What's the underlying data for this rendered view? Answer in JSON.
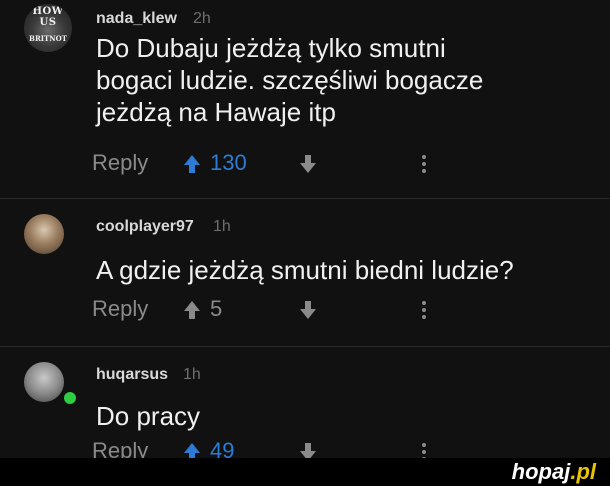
{
  "comments": [
    {
      "avatar_text_top": "HOW US",
      "avatar_text_bottom": "BRITNOT",
      "username": "nada_klew",
      "time": "2h",
      "text_lines": [
        "Do Dubaju jeżdżą tylko smutni",
        "bogaci ludzie. szczęśliwi bogacze",
        "jeżdżą na Hawaje itp"
      ],
      "reply_label": "Reply",
      "score": "130",
      "upvoted": true
    },
    {
      "username": "coolplayer97",
      "time": "1h",
      "text_lines": [
        "A gdzie jeżdżą smutni biedni ludzie?"
      ],
      "reply_label": "Reply",
      "score": "5",
      "upvoted": false
    },
    {
      "username": "huqarsus",
      "time": "1h",
      "text_lines": [
        "Do pracy"
      ],
      "reply_label": "Reply",
      "score": "49",
      "upvoted": true,
      "online": true
    }
  ],
  "footer": {
    "watermark_main": "hopaj",
    "watermark_suffix": ".pl"
  },
  "colors": {
    "upvote_active": "#2e7bd6",
    "inactive": "#8a8a8a",
    "online": "#2ecc40",
    "background": "#111111"
  },
  "icons": {
    "upvote": "arrow-up-icon",
    "downvote": "arrow-down-icon",
    "more": "vertical-ellipsis-icon"
  }
}
